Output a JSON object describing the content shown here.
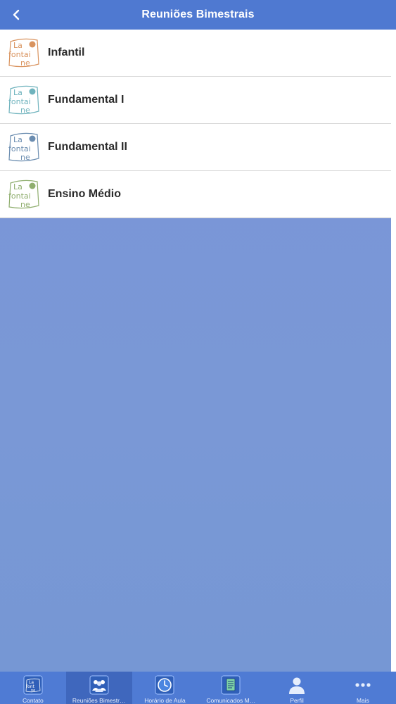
{
  "navbar": {
    "title": "Reuniões Bimestrais",
    "back_icon": "chevron-left-icon"
  },
  "list": {
    "items": [
      {
        "label": "Infantil",
        "logo_color": "#d9935e"
      },
      {
        "label": "Fundamental I",
        "logo_color": "#6fb3bd"
      },
      {
        "label": "Fundamental II",
        "logo_color": "#6b8db0"
      },
      {
        "label": "Ensino Médio",
        "logo_color": "#8fae6e"
      }
    ],
    "logo_text": {
      "line1": "La",
      "line2": "fontai",
      "line3": "ne"
    }
  },
  "tabbar": {
    "tabs": [
      {
        "label": "Contato",
        "icon": "la-fontaine-logo-icon",
        "active": false
      },
      {
        "label": "Reuniões Bimestr…",
        "icon": "meeting-people-icon",
        "active": true
      },
      {
        "label": "Horário de Aula",
        "icon": "clock-globe-icon",
        "active": false
      },
      {
        "label": "Comunicados M…",
        "icon": "document-icon",
        "active": false
      },
      {
        "label": "Perfil",
        "icon": "person-icon",
        "active": false
      },
      {
        "label": "Mais",
        "icon": "more-dots-icon",
        "active": false
      }
    ]
  },
  "colors": {
    "navbar": "#4f79d1",
    "tabbar": "#4f7bd4",
    "tab_active": "#3f67bd",
    "background": "#7a95d8"
  }
}
